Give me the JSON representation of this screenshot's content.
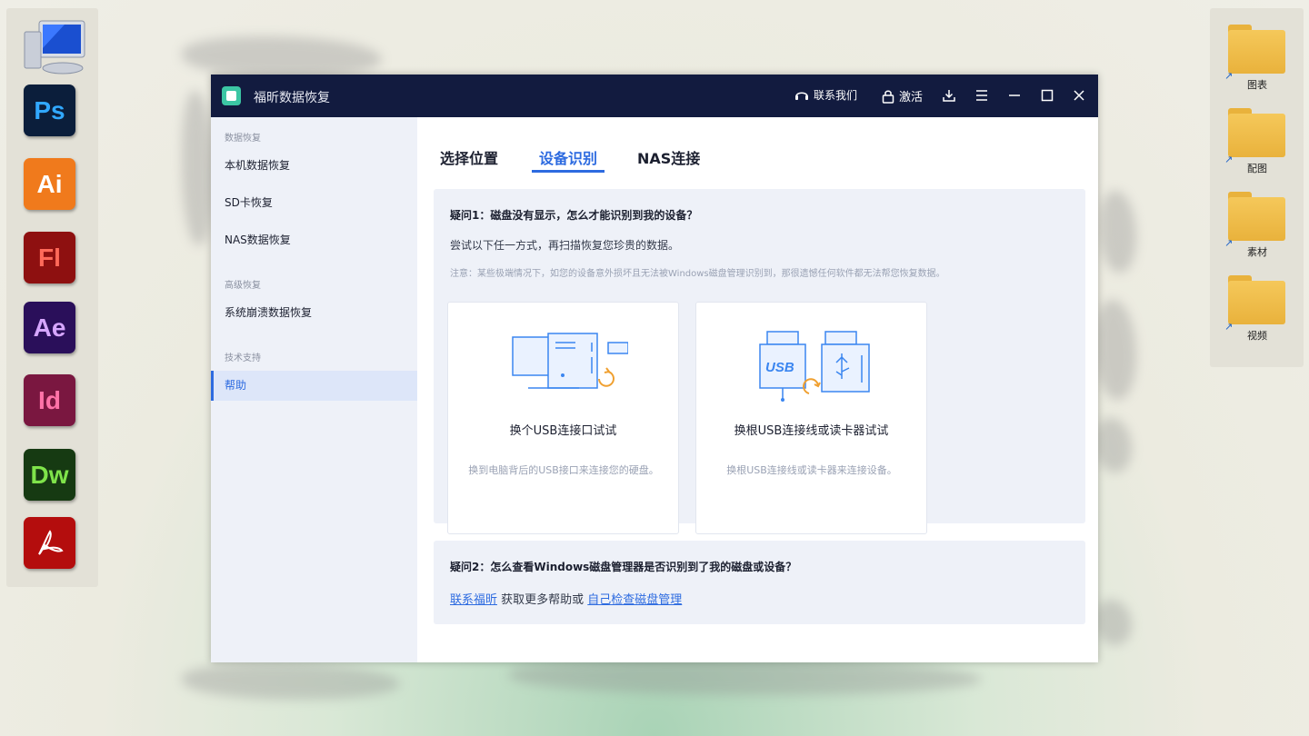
{
  "desktop": {
    "left_dock": [
      {
        "name": "my-computer",
        "label": "",
        "color": ""
      },
      {
        "name": "photoshop",
        "label": "Ps",
        "bg": "#0b1e3b",
        "fg": "#31a8ff"
      },
      {
        "name": "illustrator",
        "label": "Ai",
        "bg": "#f07a1c",
        "fg": "#ffffff"
      },
      {
        "name": "flash",
        "label": "Fl",
        "bg": "#8e1010",
        "fg": "#ff6a5a"
      },
      {
        "name": "after-effects",
        "label": "Ae",
        "bg": "#2a0f5a",
        "fg": "#d6a6ff"
      },
      {
        "name": "indesign",
        "label": "Id",
        "bg": "#7a1740",
        "fg": "#ff73a8"
      },
      {
        "name": "dreamweaver",
        "label": "Dw",
        "bg": "#163a12",
        "fg": "#7fe34a"
      },
      {
        "name": "acrobat",
        "label": "",
        "bg": "#b40d0d",
        "fg": "#ffffff"
      }
    ],
    "right_dock": [
      {
        "label": "图表"
      },
      {
        "label": "配图"
      },
      {
        "label": "素材"
      },
      {
        "label": "视频"
      }
    ]
  },
  "window": {
    "title": "福昕数据恢复",
    "contact_label": "联系我们",
    "activate_label": "激活"
  },
  "sidebar": {
    "group1": "数据恢复",
    "items1": [
      "本机数据恢复",
      "SD卡恢复",
      "NAS数据恢复"
    ],
    "group2": "高级恢复",
    "items2": [
      "系统崩溃数据恢复"
    ],
    "group3": "技术支持",
    "items3": [
      "帮助"
    ]
  },
  "tabs": [
    "选择位置",
    "设备识别",
    "NAS连接"
  ],
  "faq1": {
    "title": "疑问1：磁盘没有显示，怎么才能识别到我的设备？",
    "text": "尝试以下任一方式，再扫描恢复您珍贵的数据。",
    "note": "注意：某些极端情况下，如您的设备意外损坏且无法被Windows磁盘管理识别到，那很遗憾任何软件都无法帮您恢复数据。"
  },
  "cards": [
    {
      "title": "换个USB连接口试试",
      "desc": "换到电脑背后的USB接口来连接您的硬盘。"
    },
    {
      "title": "换根USB连接线或读卡器试试",
      "desc": "换根USB连接线或读卡器来连接设备。",
      "usb_text": "USB"
    }
  ],
  "faq2": {
    "title": "疑问2：怎么查看Windows磁盘管理器是否识别到了我的磁盘或设备？",
    "link1": "联系福昕",
    "middle": " 获取更多帮助或 ",
    "link2": "自己检查磁盘管理"
  },
  "colors": {
    "accent": "#2d6be0",
    "titlebar": "#121b3f",
    "orange": "#f0a030"
  }
}
